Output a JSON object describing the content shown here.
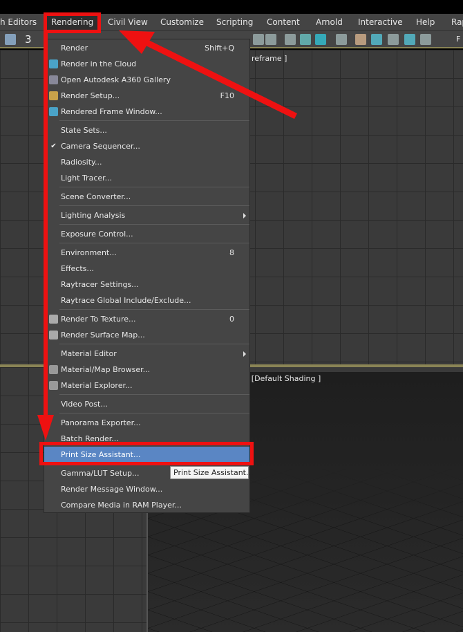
{
  "menubar": [
    "h Editors",
    "Rendering",
    "Civil View",
    "Customize",
    "Scripting",
    "Content",
    "Arnold",
    "Interactive",
    "Help",
    "Rap"
  ],
  "toolbar": {
    "frame_label": "F",
    "counter": "3"
  },
  "viewports": {
    "top_right_label": "reframe ]",
    "bottom_label": "] [Default Shading ]"
  },
  "menu": {
    "groups": [
      [
        {
          "label": "Render",
          "shortcut": "Shift+Q"
        },
        {
          "label": "Render in the Cloud",
          "icon": "cloud-teapot-icon"
        },
        {
          "label": "Open Autodesk A360 Gallery",
          "icon": "gallery-icon"
        },
        {
          "label": "Render Setup...",
          "shortcut": "F10",
          "icon": "teapot-gear-icon"
        },
        {
          "label": "Rendered Frame Window...",
          "icon": "frame-window-icon"
        }
      ],
      [
        {
          "label": "State Sets..."
        },
        {
          "label": "Camera Sequencer...",
          "checked": true
        },
        {
          "label": "Radiosity..."
        },
        {
          "label": "Light Tracer..."
        }
      ],
      [
        {
          "label": "Scene Converter..."
        }
      ],
      [
        {
          "label": "Lighting Analysis",
          "submenu": true
        }
      ],
      [
        {
          "label": "Exposure Control..."
        }
      ],
      [
        {
          "label": "Environment...",
          "shortcut": "8"
        },
        {
          "label": "Effects..."
        },
        {
          "label": "Raytracer Settings..."
        },
        {
          "label": "Raytrace Global Include/Exclude..."
        }
      ],
      [
        {
          "label": "Render To Texture...",
          "shortcut": "0",
          "icon": "teapot-texture-icon"
        },
        {
          "label": "Render Surface Map...",
          "icon": "surface-map-icon"
        }
      ],
      [
        {
          "label": "Material Editor",
          "submenu": true
        },
        {
          "label": "Material/Map Browser...",
          "icon": "material-browser-icon"
        },
        {
          "label": "Material Explorer...",
          "icon": "material-explorer-icon"
        }
      ],
      [
        {
          "label": "Video Post..."
        }
      ],
      [
        {
          "label": "Panorama Exporter..."
        },
        {
          "label": "Batch Render..."
        },
        {
          "label": "Print Size Assistant...",
          "highlighted": true
        }
      ],
      [
        {
          "label": "Gamma/LUT Setup..."
        },
        {
          "label": "Render Message Window..."
        },
        {
          "label": "Compare Media in RAM Player..."
        }
      ]
    ]
  },
  "tooltip": "Print Size Assistant...",
  "colors": {
    "annotation": "#ee1111",
    "highlight": "#5a86c4"
  }
}
